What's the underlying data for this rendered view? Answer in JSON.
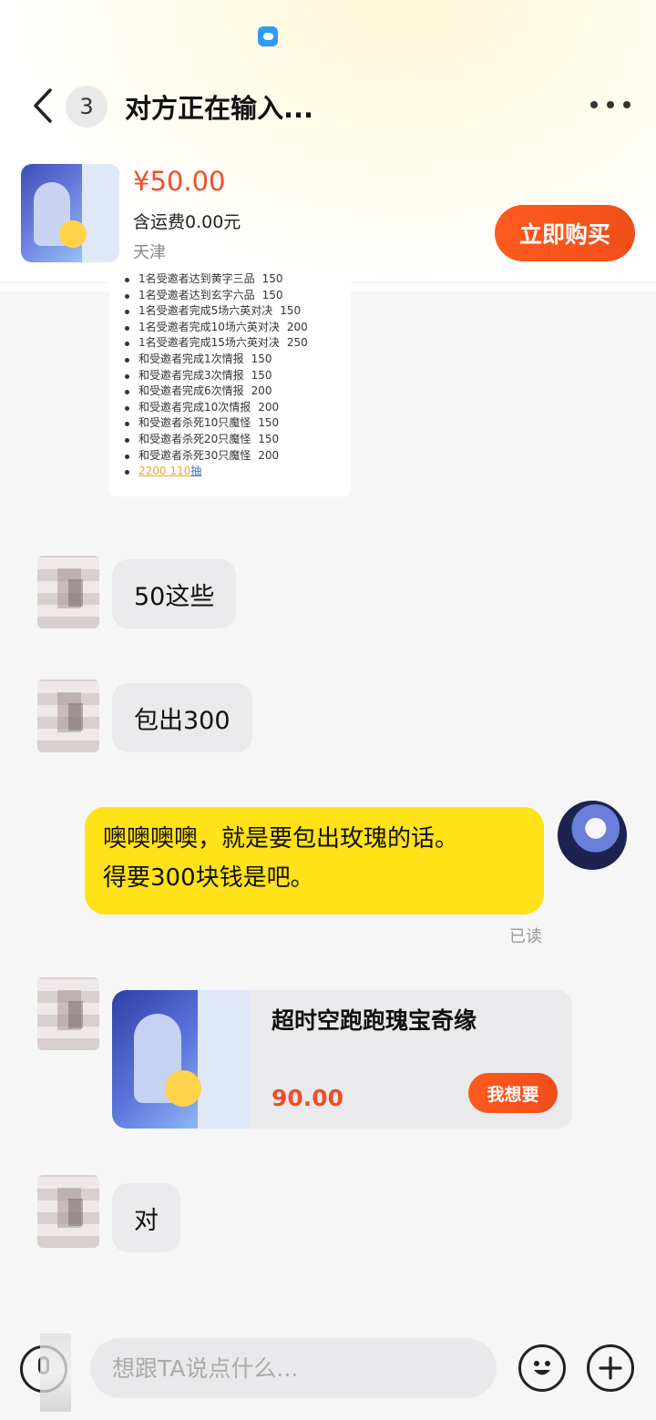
{
  "header": {
    "unread_count": "3",
    "title": "对方正在输入..."
  },
  "product": {
    "price": "¥50.00",
    "shipping": "含运费0.00元",
    "location": "天津",
    "buy_label": "立即购买"
  },
  "rules_image": {
    "items": [
      {
        "text": "1名受邀者达到黄字三品",
        "points": "150"
      },
      {
        "text": "1名受邀者达到玄字六品",
        "points": "150"
      },
      {
        "text": "1名受邀者完成5场六英对决",
        "points": "150"
      },
      {
        "text": "1名受邀者完成10场六英对决",
        "points": "200"
      },
      {
        "text": "1名受邀者完成15场六英对决",
        "points": "250"
      },
      {
        "text": "和受邀者完成1次情报",
        "points": "150"
      },
      {
        "text": "和受邀者完成3次情报",
        "points": "150"
      },
      {
        "text": "和受邀者完成6次情报",
        "points": "200"
      },
      {
        "text": "和受邀者完成10次情报",
        "points": "200"
      },
      {
        "text": "和受邀者杀死10只魔怪",
        "points": "150"
      },
      {
        "text": "和受邀者杀死20只魔怪",
        "points": "150"
      },
      {
        "text": "和受邀者杀死30只魔怪",
        "points": "200"
      }
    ],
    "total_numbers": "2200 110",
    "total_suffix": "抽"
  },
  "messages": {
    "m1": "50这些",
    "m2": "包出300",
    "m3_line1": "噢噢噢噢，就是要包出玫瑰的话。",
    "m3_line2": "得要300块钱是吧。",
    "m3_status": "已读",
    "m5": "对"
  },
  "card": {
    "title": "超时空跑跑瑰宝奇缘",
    "price": "90.00",
    "want_label": "我想要"
  },
  "input": {
    "placeholder": "想跟TA说点什么..."
  },
  "colors": {
    "accent_orange": "#f04e2a",
    "my_bubble": "#ffe217",
    "their_bubble": "#eaeaec"
  }
}
